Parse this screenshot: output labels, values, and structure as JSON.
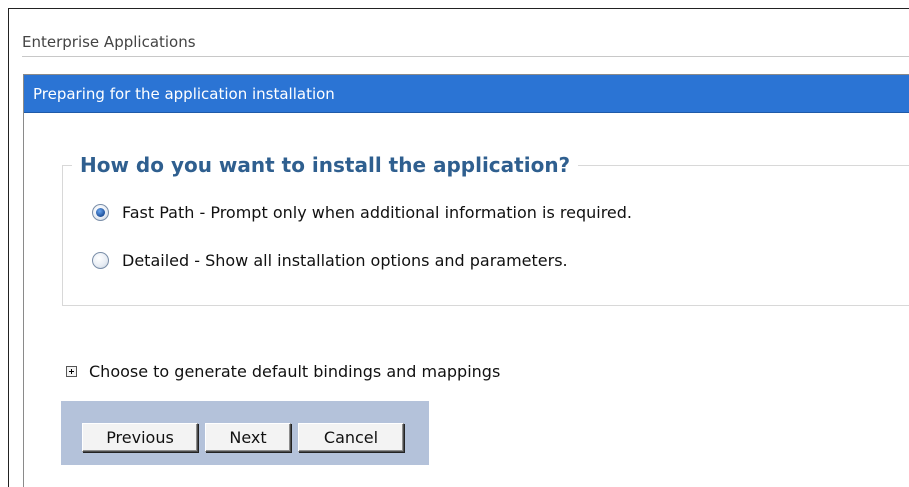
{
  "breadcrumb": "Enterprise Applications",
  "panel": {
    "title": "Preparing for the application installation"
  },
  "install_question": {
    "legend": "How do you want to install the application?",
    "options": [
      {
        "label": "Fast Path - Prompt only when additional information is required.",
        "selected": true
      },
      {
        "label": "Detailed - Show all installation options and parameters.",
        "selected": false
      }
    ]
  },
  "expander": {
    "label": "Choose to generate default bindings and mappings",
    "icon": "plus-box-icon",
    "expanded": false
  },
  "buttons": {
    "previous": "Previous",
    "next": "Next",
    "cancel": "Cancel"
  },
  "colors": {
    "header_bg": "#2b74d4",
    "legend_text": "#2f5f8f",
    "button_bar_bg": "#b4c2da"
  }
}
